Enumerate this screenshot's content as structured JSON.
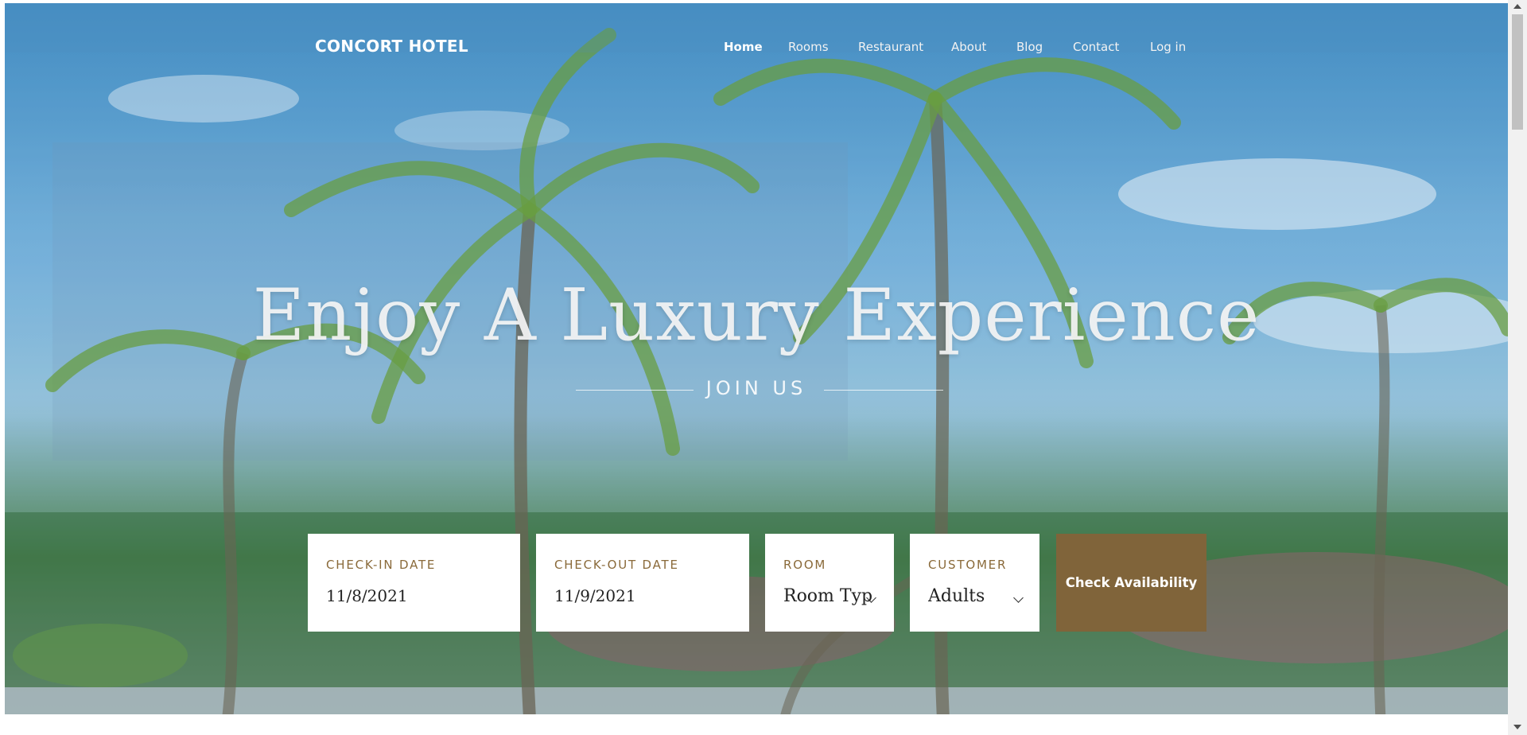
{
  "brand": "CONCORT HOTEL",
  "nav": [
    {
      "label": "Home",
      "active": true
    },
    {
      "label": "Rooms",
      "active": false
    },
    {
      "label": "Restaurant",
      "active": false
    },
    {
      "label": "About",
      "active": false
    },
    {
      "label": "Blog",
      "active": false
    },
    {
      "label": "Contact",
      "active": false
    },
    {
      "label": "Log in",
      "active": false
    }
  ],
  "hero": {
    "headline": "Enjoy A Luxury Experience",
    "subline": "JOIN US"
  },
  "booking": {
    "checkin": {
      "label": "CHECK-IN DATE",
      "value": "11/8/2021"
    },
    "checkout": {
      "label": "CHECK-OUT DATE",
      "value": "11/9/2021"
    },
    "room": {
      "label": "ROOM",
      "value": "Room Type"
    },
    "customer": {
      "label": "CUSTOMER",
      "value": "Adults"
    },
    "submit_label": "Check Availability"
  },
  "colors": {
    "accent": "#80643a",
    "label_text": "#8a6a3a"
  }
}
